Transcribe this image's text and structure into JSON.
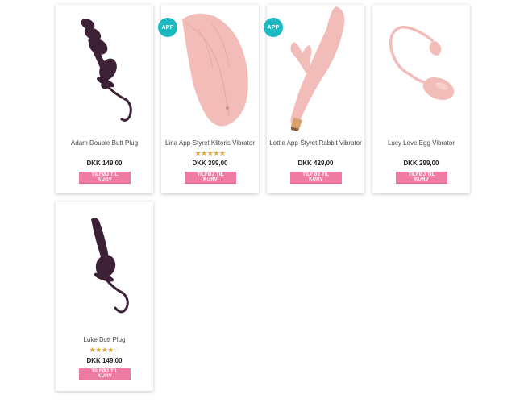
{
  "products": [
    {
      "name": "Adam Double Butt Plug",
      "price": "DKK 149,00",
      "button": "TILFØJ TIL KURV",
      "badge": "",
      "rating": null,
      "image": "dark-plum-butt-plug"
    },
    {
      "name": "Lina App-Styret Klitoris Vibrator",
      "price": "DKK 399,00",
      "button": "TILFØJ TIL KURV",
      "badge": "APP",
      "rating": 5,
      "image": "pink-leaf-vibrator"
    },
    {
      "name": "Lottie App-Styret Rabbit Vibrator",
      "price": "DKK 429,00",
      "button": "TILFØJ TIL KURV",
      "badge": "APP",
      "rating": null,
      "image": "pink-rabbit-vibrator"
    },
    {
      "name": "Lucy Love Egg Vibrator",
      "price": "DKK 299,00",
      "button": "TILFØJ TIL KURV",
      "badge": "",
      "rating": null,
      "image": "pink-love-egg"
    },
    {
      "name": "Luke Butt Plug",
      "price": "DKK 149,00",
      "button": "TILFØJ TIL KURV",
      "badge": "",
      "rating": 4,
      "image": "dark-plum-butt-plug"
    }
  ],
  "colors": {
    "badge": "#1bb9c1",
    "button": "#f07ba2",
    "star": "#e1a83a",
    "plum": "#3c2036",
    "pink": "#f2bdb8"
  }
}
